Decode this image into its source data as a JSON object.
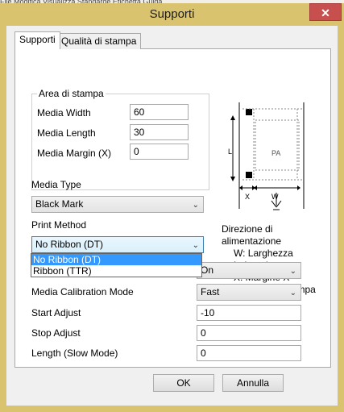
{
  "window": {
    "title": "Supporti",
    "close_glyph": "✕",
    "background_strip_text": "File   Modifica   Visualizza   Standarde   Etichetta   Guida"
  },
  "tabs": [
    {
      "label": "Supporti",
      "active": true
    },
    {
      "label": "Qualità di stampa",
      "active": false
    }
  ],
  "print_area_group": {
    "title": "Area di stampa",
    "fields": [
      {
        "label": "Media Width",
        "value": "60"
      },
      {
        "label": "Media Length",
        "value": "30"
      },
      {
        "label": "Media Margin (X)",
        "value": "0"
      }
    ]
  },
  "media_type": {
    "label": "Media Type",
    "value": "Black Mark"
  },
  "print_method": {
    "label": "Print Method",
    "value": "No Ribbon (DT)",
    "options": [
      "No Ribbon (DT)",
      "Ribbon (TTR)"
    ]
  },
  "hidden_combo_value": "On",
  "media_calibration": {
    "label": "Media Calibration Mode",
    "value": "Fast"
  },
  "start_adjust": {
    "label": "Start Adjust",
    "value": "-10"
  },
  "stop_adjust": {
    "label": "Stop Adjust",
    "value": "0"
  },
  "length_slow": {
    "label": "Length (Slow Mode)",
    "value": "0"
  },
  "diagram": {
    "L": "L",
    "PA": "PA",
    "X": "X",
    "W": "W"
  },
  "legend": {
    "title": "Direzione di alimentazione",
    "items": [
      "W: Larghezza",
      "L: Lunghezza",
      "X: Margine X",
      "PA: Area di stampa"
    ]
  },
  "buttons": {
    "ok": "OK",
    "cancel": "Annulla"
  }
}
